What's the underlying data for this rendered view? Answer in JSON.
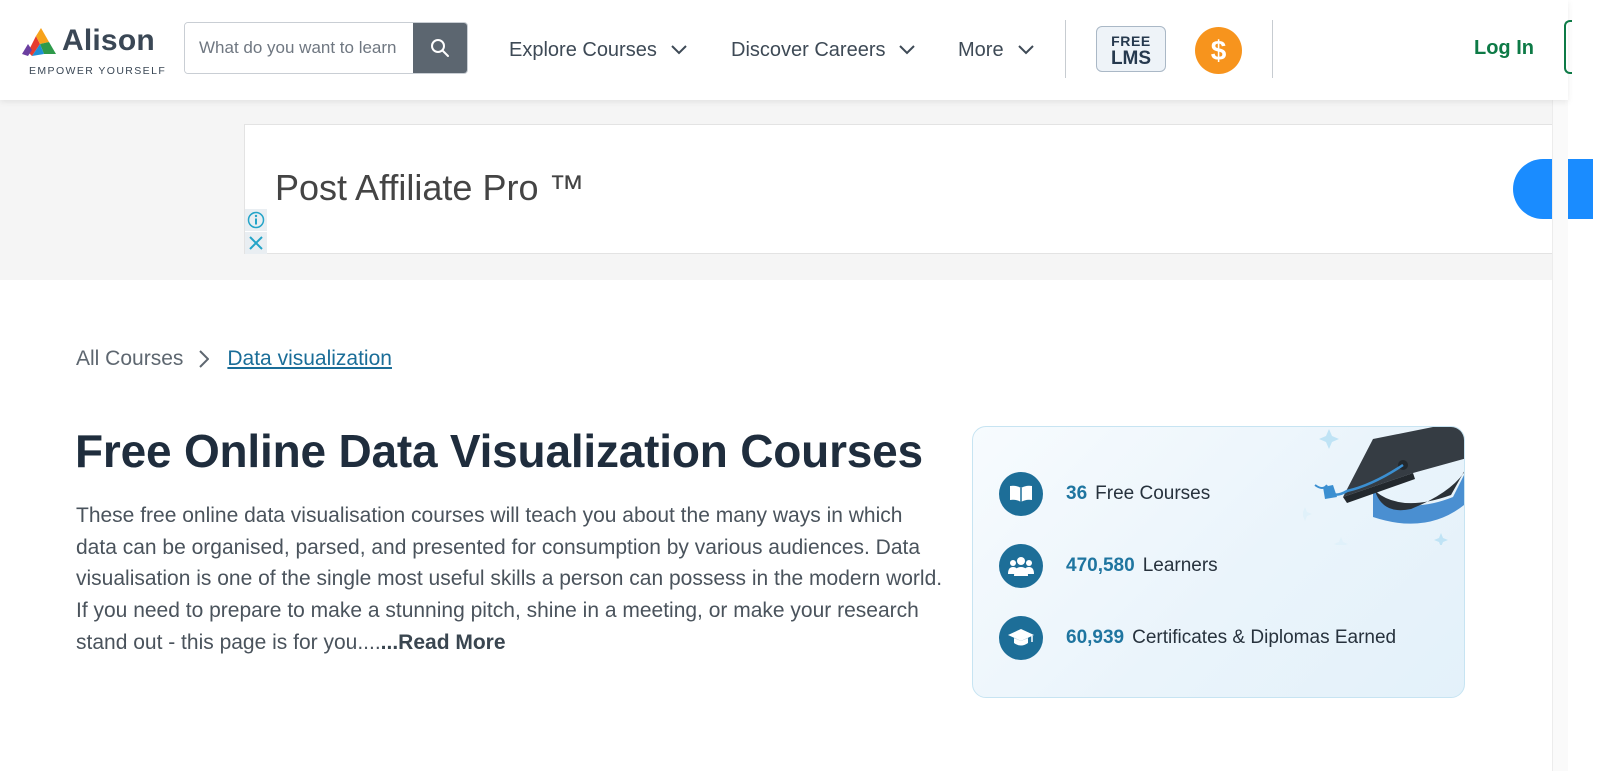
{
  "header": {
    "logo_word": "Alison",
    "logo_tagline": "EMPOWER YOURSELF",
    "search_placeholder": "What do you want to learn",
    "nav": [
      {
        "label": "Explore Courses"
      },
      {
        "label": "Discover Careers"
      },
      {
        "label": "More"
      }
    ],
    "lms_line1": "FREE",
    "lms_line2": "LMS",
    "coin_symbol": "$",
    "login_label": "Log In"
  },
  "ad": {
    "title": "Post Affiliate Pro ™"
  },
  "breadcrumb": {
    "home": "All Courses",
    "current": "Data visualization"
  },
  "page": {
    "title": "Free Online Data Visualization Courses",
    "description": "These free online data visualisation courses will teach you about the many ways in which data can be organised, parsed, and presented for consumption by various audiences. Data visualisation is one of the single most useful skills a person can possess in the modern world. If you need to prepare to make a stunning pitch, shine in a meeting, or make your research stand out - this page is for you....",
    "read_more": "...Read More"
  },
  "stats": [
    {
      "icon": "book-icon",
      "value": "36",
      "label": "Free Courses"
    },
    {
      "icon": "learners-icon",
      "value": "470,580",
      "label": "Learners"
    },
    {
      "icon": "graduation-cap-icon",
      "value": "60,939",
      "label": "Certificates & Diplomas Earned"
    }
  ],
  "colors": {
    "brand_green": "#0d7a46",
    "stat_blue": "#1d6e98",
    "coin_orange": "#f7941d",
    "ad_blue": "#1a8cff"
  }
}
